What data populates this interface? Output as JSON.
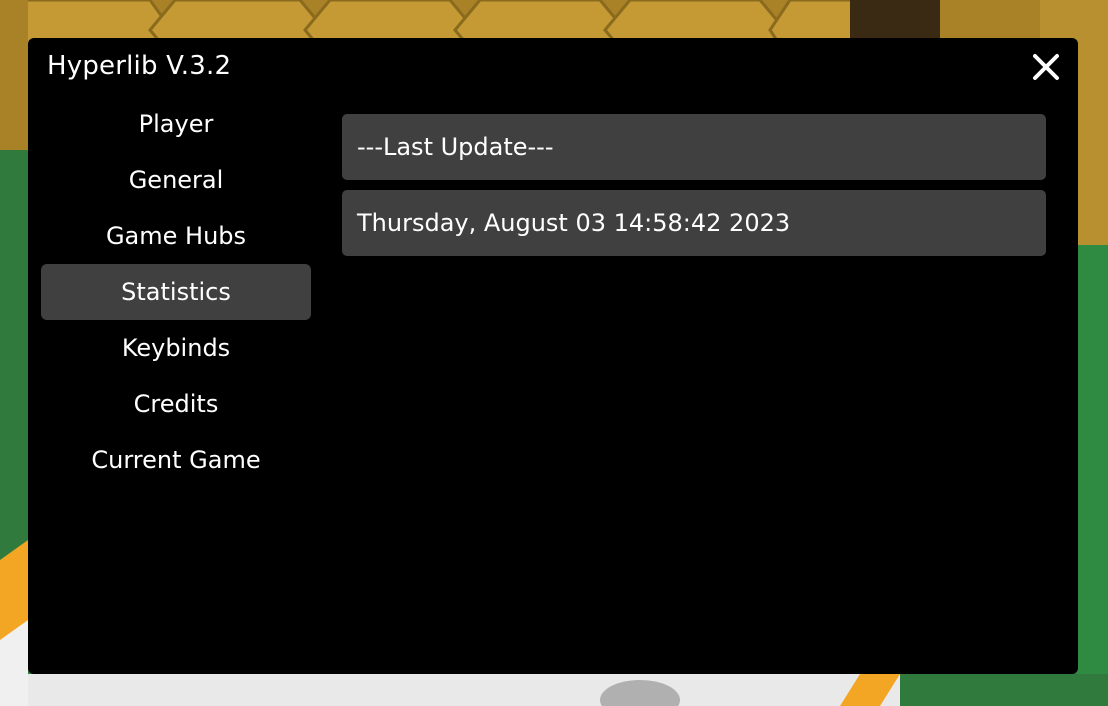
{
  "window": {
    "title": "Hyperlib V.3.2",
    "close_icon": "close-icon"
  },
  "sidebar": {
    "items": [
      {
        "label": "Player",
        "active": false
      },
      {
        "label": "General",
        "active": false
      },
      {
        "label": "Game Hubs",
        "active": false
      },
      {
        "label": "Statistics",
        "active": true
      },
      {
        "label": "Keybinds",
        "active": false
      },
      {
        "label": "Credits",
        "active": false
      },
      {
        "label": "Current Game",
        "active": false
      }
    ]
  },
  "content": {
    "rows": [
      {
        "text": "---Last Update---"
      },
      {
        "text": "Thursday, August 03 14:58:42 2023"
      }
    ]
  },
  "colors": {
    "window_bg": "#000000",
    "row_bg": "#404040",
    "active_item_bg": "#404040",
    "text": "#ffffff",
    "background_green": "#2f7a3c",
    "background_gold": "#b8902f",
    "background_orange": "#f3a524"
  }
}
